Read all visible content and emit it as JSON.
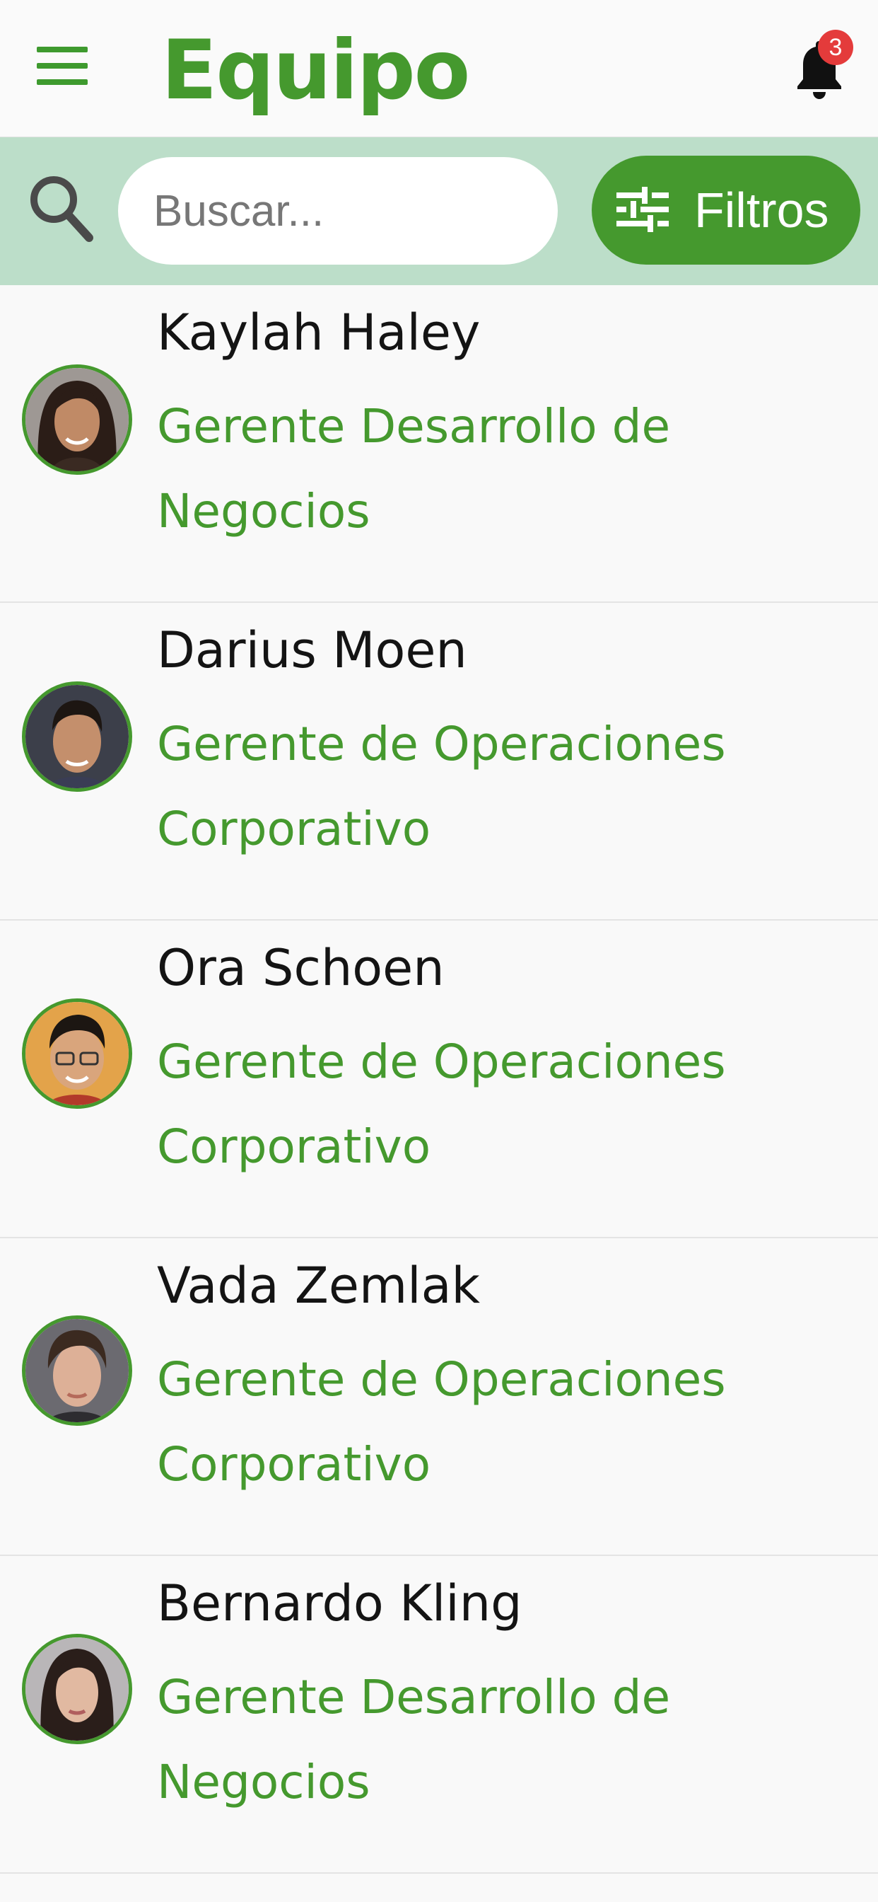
{
  "header": {
    "title": "Equipo",
    "notification_count": "3",
    "menu_icon": "hamburger-menu-icon",
    "bell_icon": "bell-icon"
  },
  "search": {
    "placeholder": "Buscar...",
    "value": "",
    "icon": "search-icon"
  },
  "filters": {
    "label": "Filtros",
    "icon": "sliders-icon"
  },
  "colors": {
    "accent": "#45992e",
    "search_bar_bg": "#bcdec9",
    "badge": "#e43b3b",
    "background": "#f9f9f9"
  },
  "members": [
    {
      "name": "Kaylah Haley",
      "role": "Gerente Desarrollo de Negocios",
      "avatar": "avatar-photo"
    },
    {
      "name": "Darius Moen",
      "role": "Gerente de Operaciones Corporativo",
      "avatar": "avatar-photo"
    },
    {
      "name": "Ora Schoen",
      "role": "Gerente de Operaciones Corporativo",
      "avatar": "avatar-photo"
    },
    {
      "name": "Vada Zemlak",
      "role": "Gerente de Operaciones Corporativo",
      "avatar": "avatar-photo"
    },
    {
      "name": "Bernardo Kling",
      "role": "Gerente Desarrollo de Negocios",
      "avatar": "avatar-photo"
    }
  ]
}
